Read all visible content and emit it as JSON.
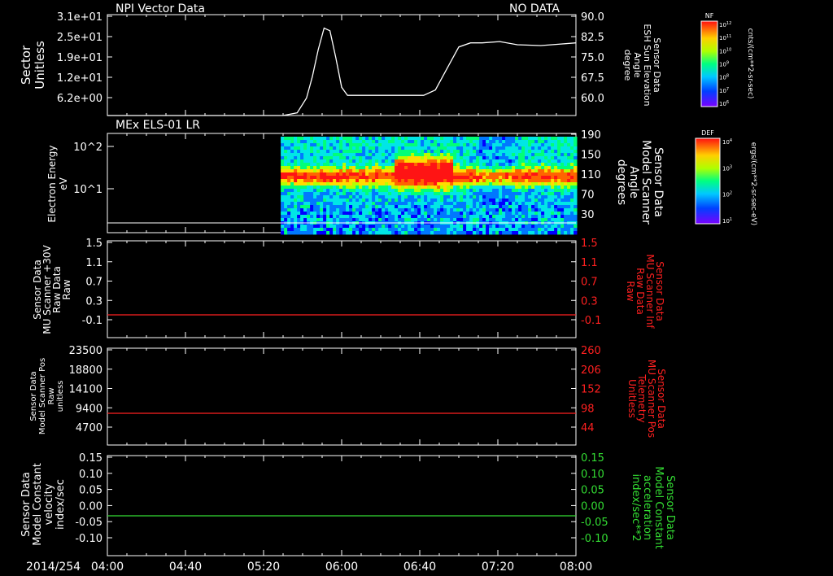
{
  "window": {
    "date_label": "2014/254"
  },
  "time_axis": {
    "labels": [
      "04:00",
      "04:40",
      "05:20",
      "06:00",
      "06:40",
      "07:20",
      "08:00"
    ],
    "range_hours": [
      4.0,
      8.0
    ]
  },
  "colors": {
    "white": "#ffffff",
    "red": "#ff2020",
    "green": "#33dd33",
    "background": "#000000"
  },
  "colorbars": [
    {
      "title": "NF",
      "unit": "cnts/(cm**2-sr-sec)",
      "ticks": [
        "10^12",
        "10^11",
        "10^10",
        "10^9",
        "10^8",
        "10^7",
        "10^6"
      ]
    },
    {
      "title": "DEF",
      "unit": "ergs/(cm**2-sr-sec-eV)",
      "ticks": [
        "10^4",
        "10^3",
        "10^2",
        "10^1"
      ]
    }
  ],
  "chart_data": [
    {
      "type": "line",
      "title_left": "NPI Vector Data",
      "title_right": "NO DATA",
      "ylabel_left": [
        "Sector",
        "Unitless"
      ],
      "ylabel_right": [
        "Sensor Data",
        "ESH Sun Elevation",
        "Angle",
        "degree"
      ],
      "yticks_left": [
        "3.1e+01",
        "2.5e+01",
        "1.9e+01",
        "1.2e+01",
        "6.2e+00"
      ],
      "yticks_right": [
        "90.0",
        "82.5",
        "75.0",
        "67.5",
        "60.0"
      ],
      "ylim_right": [
        52.5,
        90.0
      ],
      "series": [
        {
          "color": "white",
          "x": [
            4.0,
            5.5,
            5.62,
            5.7,
            5.75,
            5.8,
            5.85,
            5.9,
            5.95,
            6.0,
            6.05,
            6.2,
            6.5,
            6.7,
            6.8,
            6.9,
            7.0,
            7.1,
            7.2,
            7.35,
            7.5,
            7.7,
            7.85,
            8.0
          ],
          "y": [
            52.5,
            52.5,
            53.5,
            59,
            67,
            77,
            85,
            84,
            74,
            63,
            60,
            60,
            60,
            60,
            62,
            70,
            78,
            79.5,
            79.5,
            80,
            78.8,
            78.5,
            79,
            79.5
          ]
        }
      ]
    },
    {
      "type": "heatmap",
      "title_left": "MEx ELS-01 LR",
      "ylabel_left": [
        "Electron Energy",
        "eV"
      ],
      "ylabel_right": [
        "Sensor Data",
        "Model Scanner",
        "Angle",
        "degrees"
      ],
      "yticks_left": [
        "10^2",
        "10^1"
      ],
      "yticks_right": [
        "190",
        "150",
        "110",
        "70",
        "30"
      ],
      "data_start_time": 5.48,
      "note_line_y": "white"
    },
    {
      "type": "line",
      "ylabel_left": [
        "Sensor Data",
        "MU Scanner +30V",
        "Raw Data",
        "Raw"
      ],
      "ylabel_right": [
        "Sensor Data",
        "MU Scanner Inf",
        "Raw Data",
        "Raw"
      ],
      "yticks_left": [
        "1.5",
        "1.1",
        "0.7",
        "0.3",
        "-0.1"
      ],
      "yticks_right": [
        "1.5",
        "1.1",
        "0.7",
        "0.3",
        "-0.1"
      ],
      "ylim": [
        -0.5,
        1.5
      ],
      "series": [
        {
          "color": "red",
          "x": [
            4.0,
            8.0
          ],
          "y": [
            0.0,
            0.0
          ]
        }
      ]
    },
    {
      "type": "line",
      "ylabel_left": [
        "Sensor Data",
        "Model Scanner Pos",
        "Raw",
        "unitless"
      ],
      "ylabel_right": [
        "Sensor Data",
        "MU Scanner Pos",
        "Telemetry",
        "Unitless"
      ],
      "yticks_left": [
        "23500",
        "18800",
        "14100",
        "9400",
        "4700"
      ],
      "yticks_right": [
        "260",
        "206",
        "152",
        "98",
        "44"
      ],
      "ylim_left": [
        0,
        23500
      ],
      "series": [
        {
          "color": "red",
          "x": [
            4.0,
            8.0
          ],
          "y": [
            7400,
            7400
          ]
        }
      ]
    },
    {
      "type": "line",
      "ylabel_left": [
        "Sensor Data",
        "Model Constant",
        "velocity",
        "index/sec"
      ],
      "ylabel_right": [
        "Sensor Data",
        "Model Constant",
        "acceleration",
        "index/sec**2"
      ],
      "yticks_left": [
        "0.15",
        "0.10",
        "0.05",
        "0.00",
        "-0.05",
        "-0.10"
      ],
      "yticks_right": [
        "0.15",
        "0.10",
        "0.05",
        "0.00",
        "-0.05",
        "-0.10"
      ],
      "ylim": [
        -0.1,
        0.15
      ],
      "series": [
        {
          "color": "green",
          "x": [
            4.0,
            8.0
          ],
          "y": [
            0.0,
            0.0
          ]
        }
      ]
    }
  ]
}
